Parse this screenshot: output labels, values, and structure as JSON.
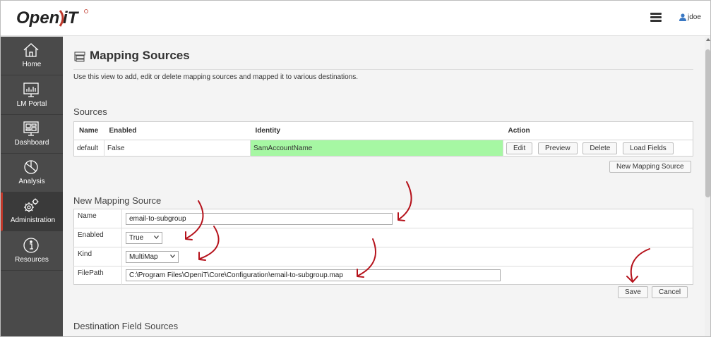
{
  "app": {
    "logo_text": "Open iT",
    "user_name": "jdoe"
  },
  "sidebar": {
    "items": [
      {
        "label": "Home",
        "icon": "home-icon"
      },
      {
        "label": "LM Portal",
        "icon": "lm-portal-icon"
      },
      {
        "label": "Dashboard",
        "icon": "dashboard-icon"
      },
      {
        "label": "Analysis",
        "icon": "analysis-icon"
      },
      {
        "label": "Administration",
        "icon": "gears-icon",
        "active": true
      },
      {
        "label": "Resources",
        "icon": "info-icon"
      }
    ]
  },
  "page": {
    "title": "Mapping Sources",
    "description": "Use this view to add, edit or delete mapping sources and mapped it to various destinations."
  },
  "sources": {
    "section_title": "Sources",
    "columns": [
      "Name",
      "Enabled",
      "Identity",
      "Action"
    ],
    "rows": [
      {
        "name": "default",
        "enabled": "False",
        "identity": "SamAccountName"
      }
    ],
    "actions": [
      "Edit",
      "Preview",
      "Delete",
      "Load Fields"
    ],
    "new_button": "New Mapping Source"
  },
  "new_source": {
    "section_title": "New Mapping Source",
    "name_label": "Name",
    "name_value": "email-to-subgroup",
    "enabled_label": "Enabled",
    "enabled_value": "True",
    "kind_label": "Kind",
    "kind_value": "MultiMap",
    "filepath_label": "FilePath",
    "filepath_value": "C:\\Program Files\\OpeniT\\Core\\Configuration\\email-to-subgroup.map",
    "save_label": "Save",
    "cancel_label": "Cancel"
  },
  "destination": {
    "section_title": "Destination Field Sources"
  },
  "colors": {
    "sidebar_bg": "#4a4a4a",
    "highlight_green": "#a6f7a3",
    "annotation_red": "#b5121b",
    "active_accent": "#c0392b"
  }
}
